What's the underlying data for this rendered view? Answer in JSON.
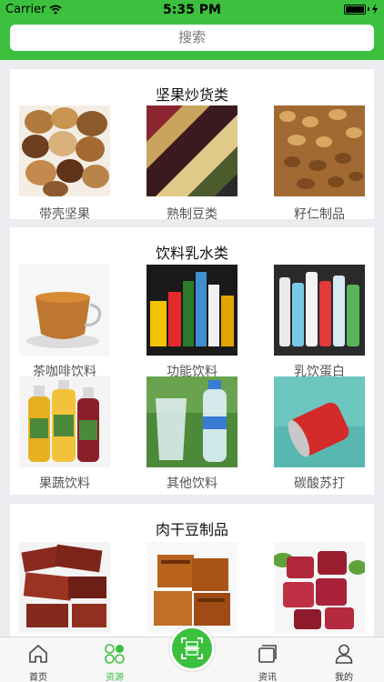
{
  "status_bar": {
    "carrier": "Carrier",
    "time": "5:35 PM"
  },
  "search": {
    "placeholder": "搜索"
  },
  "sections": [
    {
      "title": "坚果炒货类",
      "items": [
        {
          "label": "带壳坚果",
          "image": "nuts-in-shell"
        },
        {
          "label": "熟制豆类",
          "image": "cooked-beans"
        },
        {
          "label": "籽仁制品",
          "image": "kernel-products"
        }
      ]
    },
    {
      "title": "饮料乳水类",
      "items": [
        {
          "label": "茶咖啡饮料",
          "image": "tea-cup"
        },
        {
          "label": "功能饮料",
          "image": "energy-drinks"
        },
        {
          "label": "乳饮蛋白",
          "image": "milk-drinks"
        },
        {
          "label": "果蔬饮料",
          "image": "juice-bottles"
        },
        {
          "label": "其他饮料",
          "image": "water-bottles"
        },
        {
          "label": "碳酸苏打",
          "image": "soda-can"
        }
      ]
    },
    {
      "title": "肉干豆制品",
      "items": [
        {
          "label": "",
          "image": "beef-jerky"
        },
        {
          "label": "",
          "image": "dried-tofu"
        },
        {
          "label": "",
          "image": "braised-meat"
        }
      ]
    }
  ],
  "tabbar": {
    "tabs": [
      {
        "label": "首页",
        "icon": "home-icon"
      },
      {
        "label": "资源",
        "icon": "resources-icon",
        "active": true
      },
      {
        "label": "资讯",
        "icon": "news-icon"
      },
      {
        "label": "我的",
        "icon": "profile-icon"
      }
    ],
    "center": {
      "icon": "scan-icon"
    }
  },
  "colors": {
    "brand": "#3cc13f",
    "background": "#ececf0",
    "label": "#555555"
  }
}
